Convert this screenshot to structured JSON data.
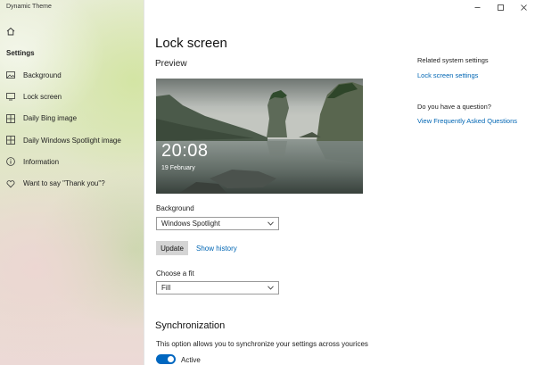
{
  "app": {
    "title": "Dynamic Theme"
  },
  "sidebar": {
    "heading": "Settings",
    "items": [
      {
        "label": "Background",
        "icon": "image-icon"
      },
      {
        "label": "Lock screen",
        "icon": "monitor-icon"
      },
      {
        "label": "Daily Bing image",
        "icon": "grid-icon"
      },
      {
        "label": "Daily Windows Spotlight image",
        "icon": "grid-icon"
      },
      {
        "label": "Information",
        "icon": "info-icon"
      },
      {
        "label": "Want to say \"Thank you\"?",
        "icon": "heart-icon"
      }
    ]
  },
  "main": {
    "title": "Lock screen",
    "preview": {
      "label": "Preview",
      "time": "20:08",
      "date": "19 February"
    },
    "background": {
      "label": "Background",
      "value": "Windows Spotlight"
    },
    "update_label": "Update",
    "show_history_label": "Show history",
    "fit": {
      "label": "Choose a fit",
      "value": "Fill"
    },
    "sync": {
      "title": "Synchronization",
      "description": "This option allows you to synchronize your settings across yourices",
      "toggle_label": "Active",
      "toggle_on": true
    }
  },
  "right": {
    "related_title": "Related system settings",
    "related_link": "Lock screen settings",
    "question_title": "Do you have a question?",
    "faq_link": "View Frequently Asked Questions"
  },
  "colors": {
    "accent": "#0067c0",
    "link": "#0066b4"
  }
}
